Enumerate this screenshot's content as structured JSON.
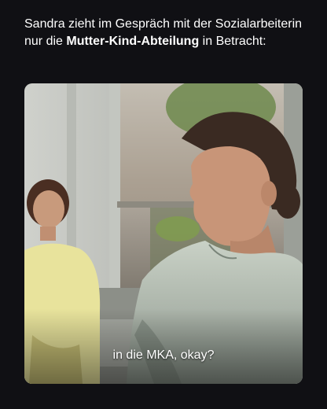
{
  "caption": {
    "part1": "Sandra zieht im Gespräch mit der Sozialarbeiterin nur die ",
    "emphasis": "Mutter-Kind-Abteilung",
    "part2": " in Betracht:"
  },
  "video": {
    "subtitle": "in die MKA, okay?"
  },
  "colors": {
    "background": "#101014",
    "text": "#ffffff"
  }
}
